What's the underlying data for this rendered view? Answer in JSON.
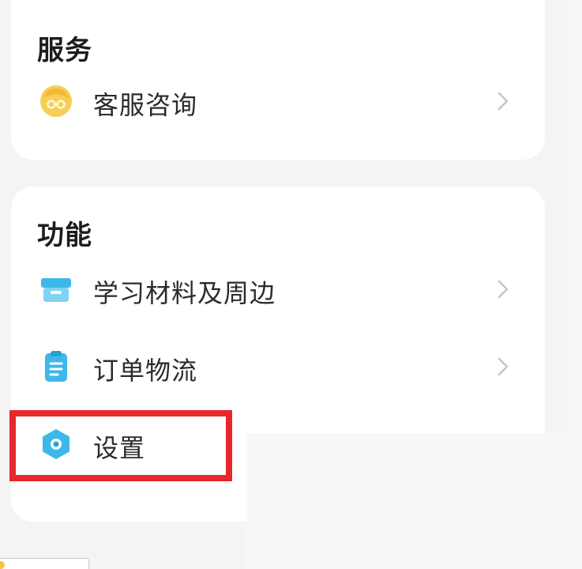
{
  "services": {
    "title": "服务",
    "items": [
      {
        "label": "客服咨询",
        "icon": "customer-service-avatar-icon"
      }
    ]
  },
  "features": {
    "title": "功能",
    "items": [
      {
        "label": "学习材料及周边",
        "icon": "package-box-icon"
      },
      {
        "label": "订单物流",
        "icon": "clipboard-icon"
      },
      {
        "label": "设置",
        "icon": "settings-hexagon-icon"
      }
    ]
  },
  "colors": {
    "highlight": "#e8262b",
    "accent_blue": "#3eb8e8",
    "accent_yellow": "#f5c84a"
  }
}
